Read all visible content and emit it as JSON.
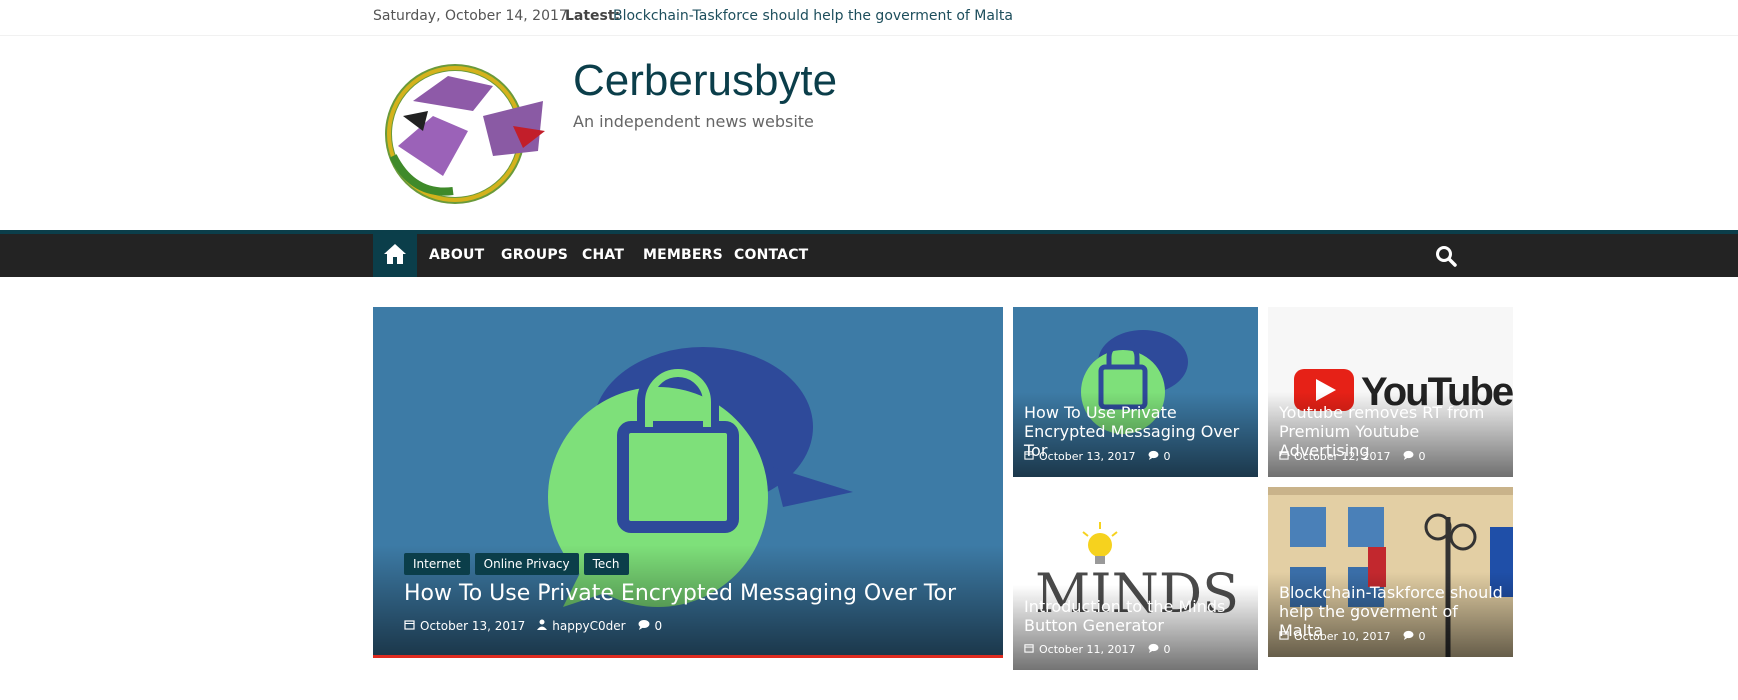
{
  "topbar": {
    "date": "Saturday, October 14, 2017",
    "latest_label": "Latest:",
    "latest_link": "Blockchain-Taskforce should help the goverment of Malta"
  },
  "site": {
    "title": "Cerberusbyte",
    "description": "An independent news website"
  },
  "nav": {
    "items": [
      "ABOUT",
      "GROUPS",
      "CHAT",
      "MEMBERS",
      "CONTACT"
    ]
  },
  "featured": {
    "categories": [
      "Internet",
      "Online Privacy",
      "Tech"
    ],
    "title": "How To Use Private Encrypted Messaging Over Tor",
    "date": "October 13, 2017",
    "author": "happyC0der",
    "comments": "0"
  },
  "posts": [
    {
      "title": "How To Use Private Encrypted Messaging Over Tor",
      "date": "October 13, 2017",
      "comments": "0"
    },
    {
      "title": "Youtube removes RT from Premium Youtube Advertising",
      "date": "October 12, 2017",
      "comments": "0"
    },
    {
      "title": "Introduction to the Minds Button Generator",
      "date": "October 11, 2017",
      "comments": "0"
    },
    {
      "title": "Blockchain-Taskforce should help the goverment of Malta",
      "date": "October 10, 2017",
      "comments": "0"
    }
  ],
  "image_text": {
    "youtube": "YouTube",
    "minds": "MINDS"
  },
  "colors": {
    "brand": "#0b3e4a",
    "nav_bg": "#232323",
    "accent_red": "#e02b20",
    "lock_green": "#7ee07a",
    "bubble_blue": "#2e4a9a"
  }
}
